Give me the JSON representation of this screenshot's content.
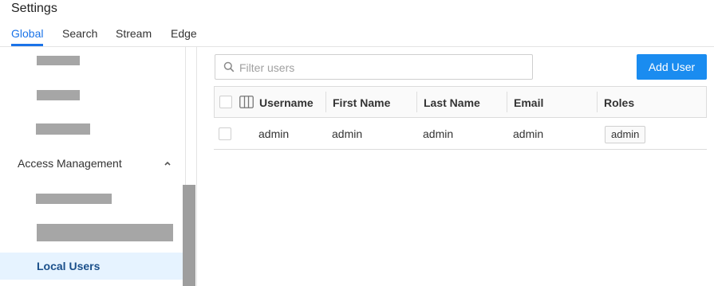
{
  "header": {
    "title": "Settings"
  },
  "tabs": [
    {
      "label": "Global",
      "active": true
    },
    {
      "label": "Search",
      "active": false
    },
    {
      "label": "Stream",
      "active": false
    },
    {
      "label": "Edge",
      "active": false
    }
  ],
  "sidebar": {
    "section_title": "Access Management",
    "active_item": "Local Users"
  },
  "toolbar": {
    "search_placeholder": "Filter users",
    "search_value": "",
    "add_button_label": "Add User"
  },
  "table": {
    "columns": [
      "Username",
      "First Name",
      "Last Name",
      "Email",
      "Roles"
    ],
    "rows": [
      {
        "username": "admin",
        "first_name": "admin",
        "last_name": "admin",
        "email": "admin",
        "roles": [
          "admin"
        ]
      }
    ]
  },
  "colors": {
    "accent": "#1a73e8",
    "button": "#1a8cf0",
    "active_item_bg": "#e6f3ff",
    "redaction": "#a6a6a6"
  }
}
